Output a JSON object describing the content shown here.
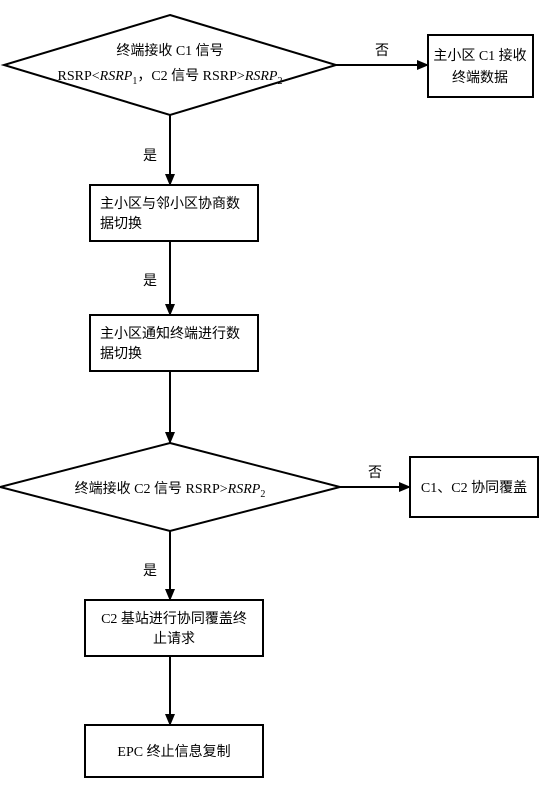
{
  "chart_data": {
    "type": "flowchart",
    "nodes": [
      {
        "id": "d1",
        "type": "decision",
        "text_lines": [
          "终端接收 C1 信号",
          "RSRP< RSRP₁，C2 信号 RSRP> RSRP₂"
        ]
      },
      {
        "id": "p1",
        "type": "process",
        "text_lines": [
          "主小区 C1 接收",
          "终端数据"
        ]
      },
      {
        "id": "p2",
        "type": "process",
        "text_lines": [
          "主小区与邻小区协商数",
          "据切换"
        ]
      },
      {
        "id": "p3",
        "type": "process",
        "text_lines": [
          "主小区通知终端进行数",
          "据切换"
        ]
      },
      {
        "id": "d2",
        "type": "decision",
        "text_lines": [
          "终端接收 C2 信号 RSRP> RSRP₂"
        ]
      },
      {
        "id": "p4",
        "type": "process",
        "text_lines": [
          "C1、C2 协同覆盖"
        ]
      },
      {
        "id": "p5",
        "type": "process",
        "text_lines": [
          "C2 基站进行协同覆盖终",
          "止请求"
        ]
      },
      {
        "id": "p6",
        "type": "process",
        "text_lines": [
          "EPC 终止信息复制"
        ]
      }
    ],
    "edges": [
      {
        "from": "d1",
        "to": "p1",
        "label": "否"
      },
      {
        "from": "d1",
        "to": "p2",
        "label": "是"
      },
      {
        "from": "p2",
        "to": "p3",
        "label": "是"
      },
      {
        "from": "p3",
        "to": "d2",
        "label": ""
      },
      {
        "from": "d2",
        "to": "p4",
        "label": "否"
      },
      {
        "from": "d2",
        "to": "p5",
        "label": "是"
      },
      {
        "from": "p5",
        "to": "p6",
        "label": ""
      }
    ]
  },
  "labels": {
    "d1_l1": "终端接收 C1 信号",
    "d1_l2a": "RSRP<",
    "d1_l2b": "RSRP",
    "d1_l2b_sub": "1",
    "d1_l2c": "，C2 信号 RSRP>",
    "d1_l2d": "RSRP",
    "d1_l2d_sub": "2",
    "p1_l1": "主小区 C1 接收",
    "p1_l2": "终端数据",
    "p2_l1": "主小区与邻小区协商数",
    "p2_l2": "据切换",
    "p3_l1": "主小区通知终端进行数",
    "p3_l2": "据切换",
    "d2_l1a": "终端接收 C2 信号 RSRP>",
    "d2_l1b": "RSRP",
    "d2_l1b_sub": "2",
    "p4_l1": "C1、C2 协同覆盖",
    "p5_l1": "C2 基站进行协同覆盖终",
    "p5_l2": "止请求",
    "p6_l1": "EPC 终止信息复制",
    "yes": "是",
    "no": "否"
  }
}
